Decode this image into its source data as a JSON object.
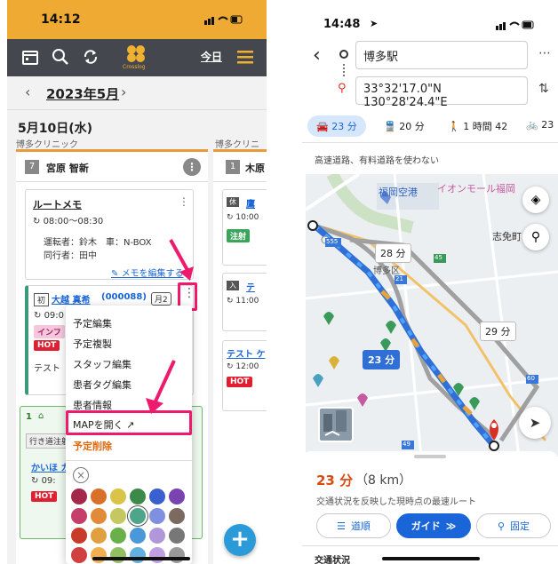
{
  "left_app": {
    "status_time": "14:12",
    "logo_text": "Crosslog",
    "today_label": "今日",
    "month_label": "2023年5月",
    "prev_arrow": "‹",
    "next_arrow": "›",
    "date_heading": "5月10日(水)",
    "clinic_name": "博多クリニック",
    "clinic_name_2": "博多クリニ",
    "column1": {
      "number": "7",
      "staff": "宮原 智新",
      "route_memo": {
        "title": "ルートメモ",
        "time": "08:00〜08:30",
        "driver": "運転者：鈴木　車：N-BOX",
        "companion": "同行者：田中",
        "edit_link": "メモを編集する"
      },
      "patient_card": {
        "badge": "初",
        "name": "大越 真希",
        "id": "(000088)",
        "month_badge": "月2",
        "time": "09:0",
        "tag1": "インフ",
        "tag2": "HOT",
        "note": "テスト"
      },
      "next_card": {
        "number": "1",
        "tag": "行き道注射",
        "name": "かいほ カ",
        "time": "09:",
        "tag2": "HOT"
      }
    },
    "column2": {
      "number": "1",
      "staff": "木原",
      "card1_badge": "休",
      "card1_name": "鷹",
      "card1_time": "10:00",
      "card1_tag": "注射",
      "card2_badge": "入",
      "card2_name": "テ",
      "card2_time": "11:00",
      "card3_name": "テスト ケ",
      "card3_time": "12:00",
      "card3_tag": "HOT"
    },
    "menu": {
      "items": [
        "予定編集",
        "予定複製",
        "スタッフ編集",
        "患者タグ編集",
        "患者情報",
        "MAPを開く",
        "予定削除"
      ],
      "close_symbol": "×"
    },
    "palette": [
      [
        "#a3294a",
        "#d9702a",
        "#d9c44a",
        "#3b8a4a",
        "#3a5fcf",
        "#7a44b0"
      ],
      [
        "#c53d6a",
        "#e08a3a",
        "#c5c860",
        "#4da58a",
        "#8090e0",
        "#7a6a60"
      ],
      [
        "#c83a2a",
        "#e0a040",
        "#6ab04a",
        "#4a98d8",
        "#b098d8",
        "#777777"
      ],
      [
        "#d04040",
        "#f0b050",
        "#90c060",
        "#60b0e0",
        "#c0a0e0",
        "#999999"
      ]
    ],
    "fab_symbol": "+"
  },
  "right_app": {
    "status_time": "14:48",
    "origin": "博多駅",
    "destination": "33°32'17.0\"N 130°28'24.4\"E",
    "modes": [
      {
        "icon": "car-icon",
        "label": "23 分"
      },
      {
        "icon": "train-icon",
        "label": "20 分"
      },
      {
        "icon": "walk-icon",
        "label": "1 時間 42"
      },
      {
        "icon": "bike-icon",
        "label": "23"
      }
    ],
    "options_text": "高速道路、有料道路を使わない",
    "map": {
      "labels": [
        "福岡空港",
        "イオンモール福岡",
        "志免町",
        "博多区",
        "555",
        "45",
        "21",
        "60",
        "49"
      ],
      "time_bubbles": [
        "28 分",
        "29 分"
      ],
      "route_bubble": "23 分"
    },
    "summary": {
      "duration": "23 分",
      "distance": "（8 km）",
      "note": "交通状況を反映した現時点の最速ルート"
    },
    "buttons": {
      "steps": "道順",
      "guide": "ガイド",
      "pin": "固定"
    },
    "traffic_label": "交通状況"
  },
  "colors": {
    "orange": "#eeaa33",
    "toolbar": "#44474d",
    "pink": "#ee1a6d",
    "link": "#1a66d9",
    "route_blue": "#4285f4"
  }
}
